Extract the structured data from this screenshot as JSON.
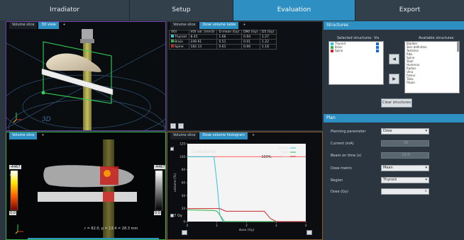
{
  "tabs": [
    {
      "label": "Irradiator",
      "active": false
    },
    {
      "label": "Setup",
      "active": false
    },
    {
      "label": "Evaluation",
      "active": true
    },
    {
      "label": "Export",
      "active": false
    }
  ],
  "top_left": {
    "tabs": [
      "Volume slice",
      "3D view",
      "+"
    ],
    "overlay_text": "3D"
  },
  "top_middle": {
    "tabs": [
      "Volume slice",
      "Dose volume table",
      "+"
    ],
    "columns": [
      "VOI",
      "VOI vol. (mm3)",
      "D mean (Gy)",
      "D90 (Gy)",
      "D5 (Gy)"
    ],
    "rows": [
      {
        "name": "Thyroid",
        "color": "#2fc4d8",
        "vol": "8.45",
        "dmean": "1.66",
        "d90": "0.94",
        "d5": "1.27"
      },
      {
        "name": "Brain",
        "color": "#2fb34a",
        "vol": "249.61",
        "dmean": "0.51",
        "d90": "0.01",
        "d5": "1.22"
      },
      {
        "name": "Spine",
        "color": "#c62828",
        "vol": "182.13",
        "dmean": "0.61",
        "d90": "0.66",
        "d5": "1.18"
      }
    ]
  },
  "bottom_left": {
    "tabs": [
      "Volume slice",
      "+"
    ],
    "coord_readout": "r = 82.0, p = 13.4 = 28.3 mm",
    "left_bar": {
      "top": "-4467",
      "mid": "0.4",
      "bottom": "0.0"
    },
    "right_bar": {
      "top": "-4467",
      "mid": "4.0",
      "bottom": "0.0"
    }
  },
  "dvh": {
    "tabs": [
      "Volume slice",
      "Dose volume histogram",
      "+"
    ],
    "cumulative_label": "Cumulative",
    "percent_label": "100%",
    "gy_label": "77 Gy",
    "corner_label": "Y"
  },
  "chart_data": {
    "type": "line",
    "title": "Cumulative",
    "xlabel": "dose (Gy)",
    "ylabel": "volume (%)",
    "xlim": [
      0,
      4
    ],
    "ylim": [
      0,
      120
    ],
    "x_ticks": [
      "0",
      "1",
      "2",
      "3",
      "4"
    ],
    "y_ticks": [
      "0",
      "20",
      "40",
      "60",
      "80",
      "100",
      "120"
    ],
    "legend_position": "top-right",
    "grid": false,
    "series": [
      {
        "name": "Thyroid",
        "color": "#2fc4d8",
        "x": [
          0,
          0.9,
          1.0,
          1.1,
          1.2,
          4
        ],
        "y": [
          100,
          100,
          60,
          10,
          0,
          0
        ]
      },
      {
        "name": "Brain",
        "color": "#2fb34a",
        "x": [
          0,
          0.9,
          1.0,
          1.1,
          1.25,
          4
        ],
        "y": [
          18,
          17,
          16,
          10,
          0,
          0
        ]
      },
      {
        "name": "Spine",
        "color": "#c62828",
        "x": [
          0,
          1.1,
          1.3,
          2.6,
          2.8,
          3.0,
          4
        ],
        "y": [
          20,
          20,
          16,
          16,
          5,
          0,
          0
        ]
      }
    ],
    "reference_line": {
      "y": 100,
      "color": "#ff4a4a"
    }
  },
  "structures": {
    "header": "Structures",
    "selected_title": "Selected structures",
    "vis_title": "Vis",
    "available_title": "Available structures",
    "selected": [
      {
        "name": "Thyroid",
        "color": "#2fc4d8"
      },
      {
        "name": "Brain",
        "color": "#2fb34a"
      },
      {
        "name": "Spine",
        "color": "#c62828"
      }
    ],
    "available": [
      "Bladder",
      "Skin definition",
      "Testicles",
      "Ribs",
      "Spine",
      "Skull",
      "Humerus",
      "Radius",
      "Ulna",
      "Femur",
      "Tibia",
      "Fibula"
    ],
    "add_arrow": "◀",
    "remove_arrow": "▶",
    "clear_button": "Clear structures"
  },
  "plan": {
    "header": "Plan",
    "fields": [
      {
        "label": "Planning parameter",
        "value": "Dose",
        "type": "select",
        "disabled": false
      },
      {
        "label": "Current (mA)",
        "value": "10",
        "type": "spin",
        "disabled": true
      },
      {
        "label": "Beam on time (s)",
        "value": "10.0",
        "type": "spin",
        "disabled": true
      },
      {
        "label": "Dose metric",
        "value": "Mean",
        "type": "select",
        "disabled": false
      },
      {
        "label": "Region",
        "value": "Thyroid",
        "type": "select",
        "disabled": false
      },
      {
        "label": "Dose (Gy)",
        "value": "",
        "type": "spin",
        "disabled": false
      }
    ]
  }
}
